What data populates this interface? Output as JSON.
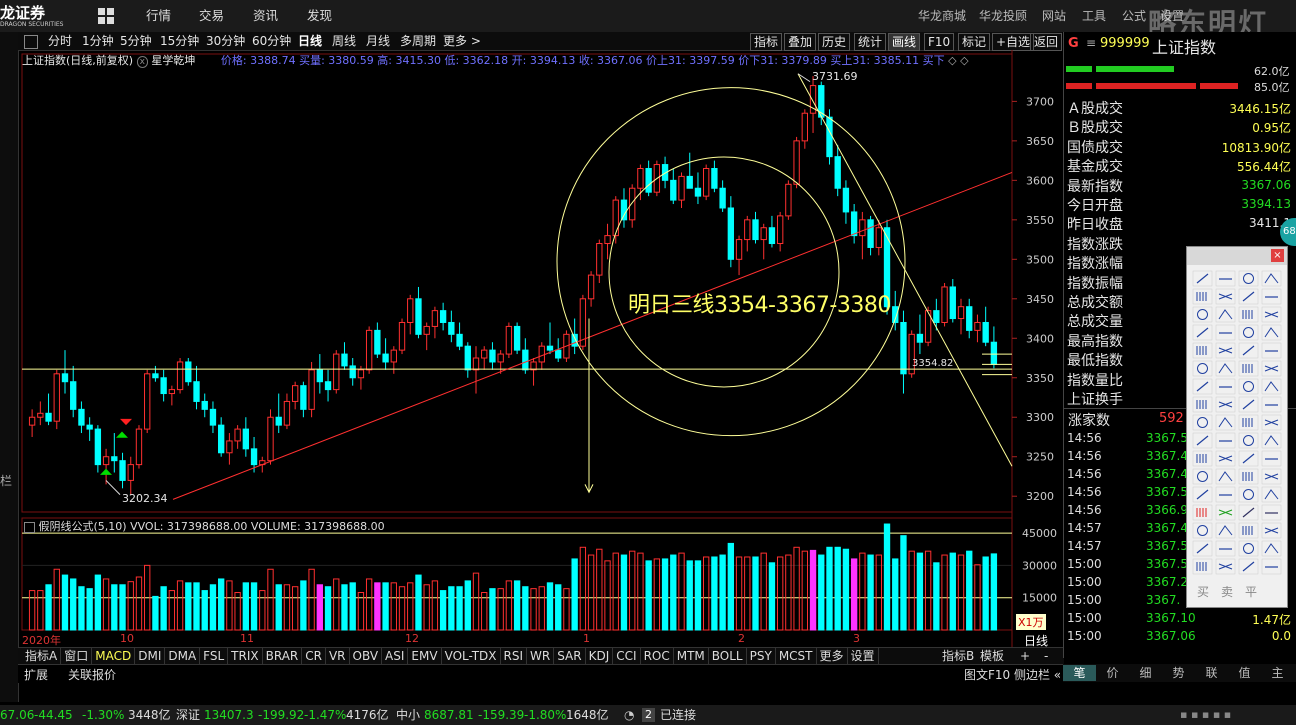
{
  "app": {
    "logo_text": "龙证券",
    "logo_sub": "DRAGON SECURITIES",
    "menu": [
      "行情",
      "交易",
      "资讯",
      "发现"
    ],
    "right_links": [
      "华龙商城",
      "华龙投顾",
      "网站",
      "工具",
      "公式",
      "设置"
    ],
    "watermark": "略东明灯"
  },
  "toolbar": {
    "periods": [
      "分时",
      "1分钟",
      "5分钟",
      "15分钟",
      "30分钟",
      "60分钟",
      "日线",
      "周线",
      "月线",
      "多周期",
      "更多 >"
    ],
    "selected_period": "日线",
    "right_buttons": [
      "指标",
      "叠加",
      "历史",
      "统计",
      "画线",
      "F10",
      "标记",
      "+自选",
      "返回"
    ],
    "selected_right": "画线"
  },
  "chart_header": {
    "title": "上证指数(日线,前复权)",
    "formula": "星学乾坤",
    "stats_text": "价格: 3388.74  买量: 3380.59  高: 3415.30  低: 3362.18  开: 3394.13  收: 3367.06  价上31: 3397.59  价下31: 3379.89  买上31: 3385.11  买下"
  },
  "chart_data": {
    "type": "candlestick",
    "ylim": [
      3180,
      3760
    ],
    "y_ticks": [
      3200,
      3250,
      3300,
      3350,
      3400,
      3450,
      3500,
      3550,
      3600,
      3650,
      3700
    ],
    "x_labels": [
      "2020年",
      "10",
      "11",
      "12",
      "1",
      "2",
      "3"
    ],
    "annotations": {
      "high_label": "3731.69",
      "low_label": "3202.34",
      "support_label": "3354.82",
      "forecast_text": "明日三线3354-3367-3380"
    },
    "ohlc": [
      [
        3290,
        3310,
        3275,
        3300
      ],
      [
        3300,
        3320,
        3290,
        3305
      ],
      [
        3305,
        3330,
        3290,
        3295
      ],
      [
        3295,
        3360,
        3285,
        3355
      ],
      [
        3355,
        3385,
        3330,
        3345
      ],
      [
        3345,
        3365,
        3300,
        3310
      ],
      [
        3310,
        3320,
        3280,
        3290
      ],
      [
        3290,
        3300,
        3270,
        3285
      ],
      [
        3285,
        3290,
        3230,
        3240
      ],
      [
        3240,
        3260,
        3215,
        3250
      ],
      [
        3250,
        3280,
        3230,
        3245
      ],
      [
        3245,
        3255,
        3210,
        3220
      ],
      [
        3220,
        3250,
        3202,
        3240
      ],
      [
        3240,
        3290,
        3235,
        3285
      ],
      [
        3285,
        3360,
        3280,
        3355
      ],
      [
        3355,
        3365,
        3345,
        3350
      ],
      [
        3350,
        3360,
        3320,
        3330
      ],
      [
        3330,
        3340,
        3315,
        3335
      ],
      [
        3335,
        3375,
        3330,
        3370
      ],
      [
        3370,
        3375,
        3340,
        3345
      ],
      [
        3345,
        3365,
        3310,
        3320
      ],
      [
        3320,
        3330,
        3300,
        3310
      ],
      [
        3310,
        3320,
        3280,
        3290
      ],
      [
        3290,
        3300,
        3250,
        3255
      ],
      [
        3255,
        3280,
        3240,
        3270
      ],
      [
        3270,
        3290,
        3260,
        3285
      ],
      [
        3285,
        3300,
        3250,
        3260
      ],
      [
        3260,
        3275,
        3230,
        3240
      ],
      [
        3240,
        3250,
        3230,
        3245
      ],
      [
        3245,
        3310,
        3240,
        3300
      ],
      [
        3300,
        3330,
        3280,
        3290
      ],
      [
        3290,
        3330,
        3285,
        3320
      ],
      [
        3320,
        3345,
        3310,
        3340
      ],
      [
        3340,
        3345,
        3300,
        3310
      ],
      [
        3310,
        3370,
        3300,
        3360
      ],
      [
        3360,
        3380,
        3330,
        3345
      ],
      [
        3345,
        3360,
        3320,
        3335
      ],
      [
        3335,
        3385,
        3330,
        3380
      ],
      [
        3380,
        3395,
        3360,
        3365
      ],
      [
        3365,
        3375,
        3340,
        3350
      ],
      [
        3350,
        3365,
        3335,
        3360
      ],
      [
        3360,
        3415,
        3355,
        3410
      ],
      [
        3410,
        3420,
        3375,
        3380
      ],
      [
        3380,
        3400,
        3360,
        3370
      ],
      [
        3370,
        3390,
        3355,
        3385
      ],
      [
        3385,
        3425,
        3380,
        3420
      ],
      [
        3420,
        3455,
        3405,
        3450
      ],
      [
        3450,
        3465,
        3400,
        3405
      ],
      [
        3405,
        3420,
        3385,
        3415
      ],
      [
        3415,
        3440,
        3400,
        3435
      ],
      [
        3435,
        3445,
        3410,
        3420
      ],
      [
        3420,
        3435,
        3395,
        3405
      ],
      [
        3405,
        3420,
        3385,
        3390
      ],
      [
        3390,
        3395,
        3350,
        3360
      ],
      [
        3360,
        3390,
        3330,
        3375
      ],
      [
        3375,
        3390,
        3360,
        3385
      ],
      [
        3385,
        3395,
        3360,
        3370
      ],
      [
        3370,
        3385,
        3355,
        3380
      ],
      [
        3380,
        3420,
        3375,
        3415
      ],
      [
        3415,
        3420,
        3380,
        3385
      ],
      [
        3385,
        3400,
        3355,
        3360
      ],
      [
        3360,
        3375,
        3340,
        3370
      ],
      [
        3370,
        3395,
        3360,
        3390
      ],
      [
        3390,
        3420,
        3380,
        3385
      ],
      [
        3385,
        3400,
        3370,
        3375
      ],
      [
        3375,
        3410,
        3370,
        3405
      ],
      [
        3405,
        3425,
        3380,
        3390
      ],
      [
        3390,
        3455,
        3385,
        3450
      ],
      [
        3450,
        3485,
        3440,
        3480
      ],
      [
        3480,
        3525,
        3470,
        3520
      ],
      [
        3520,
        3545,
        3500,
        3530
      ],
      [
        3530,
        3580,
        3520,
        3575
      ],
      [
        3575,
        3590,
        3540,
        3550
      ],
      [
        3550,
        3595,
        3540,
        3590
      ],
      [
        3590,
        3620,
        3575,
        3615
      ],
      [
        3615,
        3625,
        3580,
        3585
      ],
      [
        3585,
        3625,
        3580,
        3620
      ],
      [
        3620,
        3630,
        3590,
        3600
      ],
      [
        3600,
        3615,
        3570,
        3575
      ],
      [
        3575,
        3610,
        3565,
        3605
      ],
      [
        3605,
        3635,
        3590,
        3590
      ],
      [
        3590,
        3610,
        3570,
        3580
      ],
      [
        3580,
        3620,
        3575,
        3615
      ],
      [
        3615,
        3625,
        3585,
        3590
      ],
      [
        3590,
        3600,
        3560,
        3565
      ],
      [
        3565,
        3580,
        3490,
        3500
      ],
      [
        3500,
        3530,
        3480,
        3525
      ],
      [
        3525,
        3555,
        3510,
        3550
      ],
      [
        3550,
        3560,
        3520,
        3525
      ],
      [
        3525,
        3545,
        3500,
        3540
      ],
      [
        3540,
        3555,
        3515,
        3520
      ],
      [
        3520,
        3560,
        3510,
        3555
      ],
      [
        3555,
        3600,
        3550,
        3595
      ],
      [
        3595,
        3655,
        3590,
        3650
      ],
      [
        3650,
        3690,
        3640,
        3685
      ],
      [
        3685,
        3732,
        3660,
        3720
      ],
      [
        3720,
        3725,
        3670,
        3680
      ],
      [
        3680,
        3690,
        3620,
        3630
      ],
      [
        3630,
        3645,
        3580,
        3590
      ],
      [
        3590,
        3600,
        3545,
        3560
      ],
      [
        3560,
        3570,
        3520,
        3530
      ],
      [
        3530,
        3560,
        3500,
        3550
      ],
      [
        3550,
        3555,
        3505,
        3515
      ],
      [
        3515,
        3550,
        3505,
        3540
      ],
      [
        3540,
        3550,
        3430,
        3440
      ],
      [
        3440,
        3460,
        3410,
        3420
      ],
      [
        3420,
        3435,
        3330,
        3355
      ],
      [
        3355,
        3410,
        3350,
        3405
      ],
      [
        3405,
        3430,
        3380,
        3395
      ],
      [
        3395,
        3440,
        3390,
        3435
      ],
      [
        3435,
        3450,
        3410,
        3420
      ],
      [
        3420,
        3470,
        3415,
        3465
      ],
      [
        3465,
        3475,
        3420,
        3425
      ],
      [
        3425,
        3450,
        3405,
        3440
      ],
      [
        3440,
        3450,
        3400,
        3410
      ],
      [
        3410,
        3430,
        3395,
        3420
      ],
      [
        3420,
        3440,
        3390,
        3395
      ],
      [
        3395,
        3415,
        3362,
        3367
      ]
    ],
    "volume_axis": [
      15000,
      30000,
      45000
    ],
    "volume_unit": "X1万"
  },
  "volume_header": "假阴线公式(5,10)  VVOL: 317398688.00    VOLUME: 317398688.00",
  "right_panel": {
    "code": "999999",
    "name": "上证指数",
    "bars": [
      {
        "label": "62.0亿",
        "color": "#22cc22"
      },
      {
        "label": "85.0亿",
        "color": "#dd2222"
      }
    ],
    "rows": [
      {
        "label": "Ａ股成交",
        "value": "3446.15亿"
      },
      {
        "label": "Ｂ股成交",
        "value": "0.95亿"
      },
      {
        "label": "国债成交",
        "value": "10813.90亿"
      },
      {
        "label": "基金成交",
        "value": "556.44亿"
      },
      {
        "label": "最新指数",
        "value": "3367.06"
      },
      {
        "label": "今日开盘",
        "value": "3394.13"
      },
      {
        "label": "昨日收盘",
        "value": "3411.1"
      },
      {
        "label": "指数涨跌",
        "value": ""
      },
      {
        "label": "指数涨幅",
        "value": ""
      },
      {
        "label": "指数振幅",
        "value": ""
      },
      {
        "label": "总成交额",
        "value": ""
      },
      {
        "label": "总成交量",
        "value": ""
      },
      {
        "label": "最高指数",
        "value": ""
      },
      {
        "label": "最低指数",
        "value": ""
      },
      {
        "label": "指数量比",
        "value": ""
      },
      {
        "label": "上证换手",
        "value": ""
      }
    ],
    "rise_label": "涨家数",
    "rise_value": "592",
    "ticks": [
      {
        "time": "14:56",
        "price": "3367.5"
      },
      {
        "time": "14:56",
        "price": "3367.4"
      },
      {
        "time": "14:56",
        "price": "3367.4"
      },
      {
        "time": "14:56",
        "price": "3367.5"
      },
      {
        "time": "14:56",
        "price": "3366.9"
      },
      {
        "time": "14:57",
        "price": "3367.4"
      },
      {
        "time": "14:57",
        "price": "3367.5"
      },
      {
        "time": "15:00",
        "price": "3367.5"
      },
      {
        "time": "15:00",
        "price": "3367.2"
      },
      {
        "time": "15:00",
        "price": "3367."
      },
      {
        "time": "15:00",
        "price": "3367.10",
        "vol": "1.47亿"
      },
      {
        "time": "15:00",
        "price": "3367.06",
        "vol": "0.0"
      }
    ],
    "bottom_tabs": [
      "笔",
      "价",
      "细",
      "势",
      "联",
      "值",
      "主"
    ]
  },
  "indicator_tabs": [
    "指标A",
    "窗口",
    "MACD",
    "DMI",
    "DMA",
    "FSL",
    "TRIX",
    "BRAR",
    "CR",
    "VR",
    "OBV",
    "ASI",
    "EMV",
    "VOL-TDX",
    "RSI",
    "WR",
    "SAR",
    "KDJ",
    "CCI",
    "ROC",
    "MTM",
    "BOLL",
    "PSY",
    "MCST",
    "更多",
    "设置"
  ],
  "indicator_right": [
    "指标B",
    "模板",
    "+",
    "-"
  ],
  "day_label": "日线",
  "ext_bar": {
    "left": [
      "扩展",
      "关联报价"
    ],
    "right": "图文F10 侧边栏 «"
  },
  "drawing_palette": {
    "buttons_bottom": [
      "买",
      "卖",
      "平"
    ]
  },
  "status": {
    "sh": {
      "v1": "67.06",
      "chg": "-44.45",
      "pct": "-1.30%",
      "amt": "3448亿"
    },
    "sz": {
      "name": "深证",
      "v1": "13407.3",
      "chg": "-199.92",
      "pct": "-1.47%",
      "amt": "4176亿"
    },
    "zx": {
      "name": "中小",
      "v1": "8687.81",
      "chg": "-159.39",
      "pct": "-1.80%",
      "amt": "1648亿"
    },
    "conn": "已连接",
    "conn_num": "2"
  },
  "colors": {
    "up": "#ff3030",
    "down": "#00ffff",
    "accent": "#ffff00",
    "line": "#ff3030",
    "circle": "#ffff99"
  }
}
